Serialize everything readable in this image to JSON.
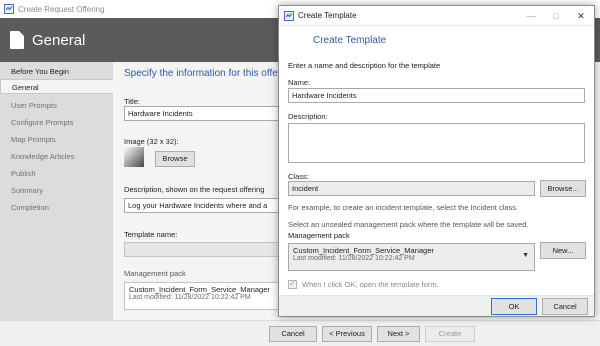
{
  "wizard": {
    "window_title": "Create Request Offering",
    "header_title": "General",
    "nav_items": [
      {
        "label": "Before You Begin",
        "state": "done"
      },
      {
        "label": "General",
        "state": "active"
      },
      {
        "label": "User Prompts",
        "state": "pending"
      },
      {
        "label": "Configure Prompts",
        "state": "pending"
      },
      {
        "label": "Map Prompts",
        "state": "pending"
      },
      {
        "label": "Knowledge Articles",
        "state": "pending"
      },
      {
        "label": "Publish",
        "state": "pending"
      },
      {
        "label": "Summary",
        "state": "pending"
      },
      {
        "label": "Completion",
        "state": "pending"
      }
    ],
    "heading": "Specify the information for this offe",
    "title_label": "Title:",
    "title_value": "Hardware Incidents",
    "image_label": "Image (32 x 32):",
    "browse_label": "Browse",
    "description_label": "Description, shown on the request offering",
    "description_value": "Log your Hardware Incidents where and a",
    "template_label": "Template name:",
    "template_value": "",
    "mp_label": "Management pack",
    "mp_name": "Custom_Incident_Form_Service_Manager",
    "mp_modified": "Last modified:  11/28/2022 10:22:42 PM",
    "footer_buttons": {
      "cancel": "Cancel",
      "previous": "< Previous",
      "next": "Next >",
      "create": "Create"
    }
  },
  "dialog": {
    "title": "Create Template",
    "heading": "Create Template",
    "intro": "Enter a name and description for the template",
    "name_label": "Name:",
    "name_value": "Hardware Incidents",
    "description_label": "Description:",
    "description_value": "",
    "class_label": "Class:",
    "class_value": "Incident",
    "class_browse": "Browse...",
    "class_hint": "For example, to create an incident template, select the Incident class.",
    "mp_instruction": "Select an unsealed management pack where the template will be saved.",
    "mp_label": "Management pack",
    "mp_name": "Custom_Incident_Form_Service_Manager",
    "mp_modified": "Last modified:  11/28/2022 10:22:42 PM",
    "new_button": "New...",
    "open_checkbox_label": "When I click OK, open the template form.",
    "open_checkbox_checked": true,
    "ok_button": "OK",
    "cancel_button": "Cancel",
    "controls": {
      "minimize": "—",
      "maximize": "□",
      "close": "✕"
    }
  },
  "colors": {
    "accent": "#2f5aa5",
    "header_bg": "#5b5b5b",
    "nav_bg": "#dcdcdc"
  }
}
